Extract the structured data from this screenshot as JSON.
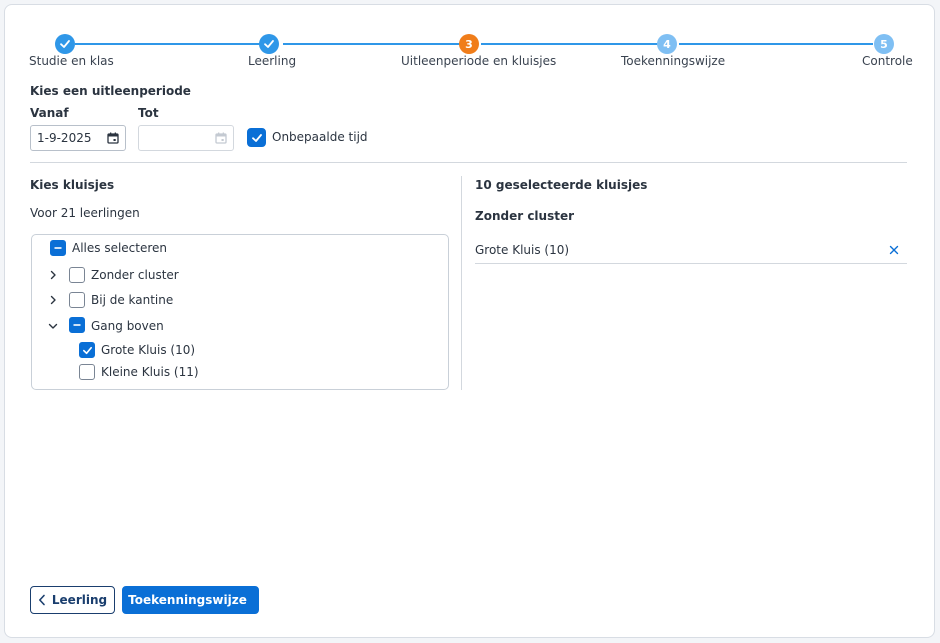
{
  "stepper": {
    "steps": [
      {
        "label": "Studie en klas",
        "state": "done"
      },
      {
        "label": "Leerling",
        "state": "done"
      },
      {
        "label": "Uitleenperiode en kluisjes",
        "state": "current",
        "number": "3"
      },
      {
        "label": "Toekenningswijze",
        "state": "future",
        "number": "4"
      },
      {
        "label": "Controle",
        "state": "future",
        "number": "5"
      }
    ],
    "colors": {
      "done": "#2f97e8",
      "current": "#f07d1a",
      "future": "#7fbff3"
    }
  },
  "period": {
    "title": "Kies een uitleenperiode",
    "from_label": "Vanaf",
    "from_value": "1-9-2025",
    "to_label": "Tot",
    "to_value": "",
    "indefinite_label": "Onbepaalde tijd",
    "indefinite_checked": true
  },
  "lockers": {
    "title": "Kies kluisjes",
    "subtitle": "Voor 21 leerlingen",
    "select_all_label": "Alles selecteren",
    "tree": [
      {
        "label": "Zonder cluster",
        "expanded": false,
        "state": "unchecked"
      },
      {
        "label": "Bij de kantine",
        "expanded": false,
        "state": "unchecked"
      },
      {
        "label": "Gang boven",
        "expanded": true,
        "state": "indeterminate",
        "children": [
          {
            "label": "Grote Kluis (10)",
            "state": "checked"
          },
          {
            "label": "Kleine Kluis (11)",
            "state": "unchecked"
          }
        ]
      }
    ]
  },
  "selected": {
    "title": "10 geselecteerde kluisjes",
    "group_title": "Zonder cluster",
    "items": [
      {
        "label": "Grote Kluis (10)"
      }
    ]
  },
  "footer": {
    "back_label": "Leerling",
    "next_label": "Toekenningswijze"
  }
}
